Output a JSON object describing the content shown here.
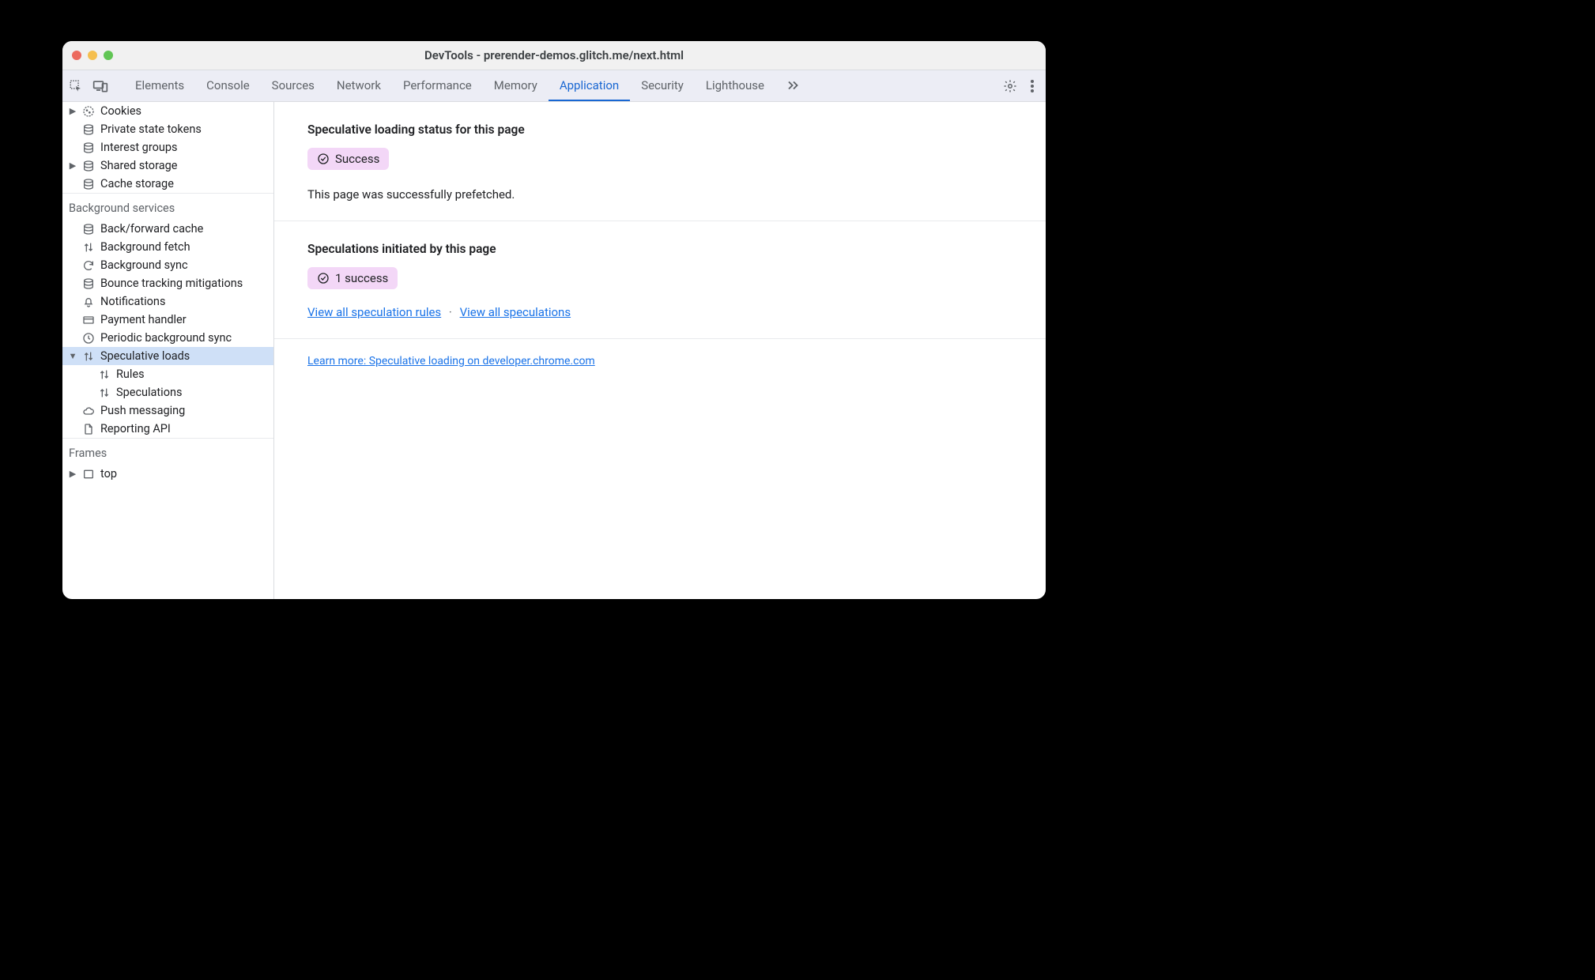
{
  "window_title": "DevTools - prerender-demos.glitch.me/next.html",
  "tabs": [
    "Elements",
    "Console",
    "Sources",
    "Network",
    "Performance",
    "Memory",
    "Application",
    "Security",
    "Lighthouse"
  ],
  "active_tab": "Application",
  "sidebar": {
    "storage_items": [
      {
        "label": "Cookies",
        "icon": "cookie",
        "chev": "right"
      },
      {
        "label": "Private state tokens",
        "icon": "db"
      },
      {
        "label": "Interest groups",
        "icon": "db"
      },
      {
        "label": "Shared storage",
        "icon": "db",
        "chev": "right"
      },
      {
        "label": "Cache storage",
        "icon": "db"
      }
    ],
    "bg_header": "Background services",
    "bg_items": [
      {
        "label": "Back/forward cache",
        "icon": "db"
      },
      {
        "label": "Background fetch",
        "icon": "updown"
      },
      {
        "label": "Background sync",
        "icon": "sync"
      },
      {
        "label": "Bounce tracking mitigations",
        "icon": "db"
      },
      {
        "label": "Notifications",
        "icon": "bell"
      },
      {
        "label": "Payment handler",
        "icon": "card"
      },
      {
        "label": "Periodic background sync",
        "icon": "clock"
      },
      {
        "label": "Speculative loads",
        "icon": "updown",
        "chev": "down",
        "selected": true
      }
    ],
    "spec_children": [
      {
        "label": "Rules",
        "icon": "updown"
      },
      {
        "label": "Speculations",
        "icon": "updown"
      }
    ],
    "bg_tail": [
      {
        "label": "Push messaging",
        "icon": "cloud"
      },
      {
        "label": "Reporting API",
        "icon": "file"
      }
    ],
    "frames_header": "Frames",
    "frames_items": [
      {
        "label": "top",
        "icon": "frame",
        "chev": "right"
      }
    ]
  },
  "main": {
    "status_heading": "Speculative loading status for this page",
    "status_badge": "Success",
    "status_desc": "This page was successfully prefetched.",
    "spec_heading": "Speculations initiated by this page",
    "spec_badge": "1 success",
    "link_rules": "View all speculation rules",
    "link_specs": "View all speculations",
    "learn_more": "Learn more: Speculative loading on developer.chrome.com"
  }
}
